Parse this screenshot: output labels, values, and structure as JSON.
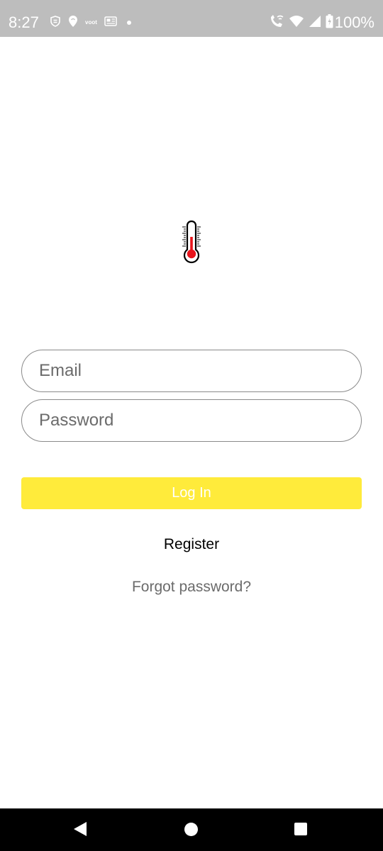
{
  "status_bar": {
    "time": "8:27",
    "left_icons": [
      "shield-s-icon",
      "location-pin-icon",
      "voot-icon",
      "news-icon",
      "dot-icon"
    ],
    "voot_label": "voot",
    "right_icons": [
      "wifi-call-icon",
      "wifi-icon",
      "signal-icon",
      "battery-icon"
    ],
    "battery_percent": "100%"
  },
  "logo": {
    "icon": "thermometer-icon",
    "accent_color": "#e8141c"
  },
  "form": {
    "email_placeholder": "Email",
    "password_placeholder": "Password",
    "login_label": "Log In",
    "login_color": "#ffeb3b",
    "register_label": "Register",
    "forgot_label": "Forgot password?"
  },
  "nav_bar": {
    "icons": [
      "back-icon",
      "home-icon",
      "recents-icon"
    ]
  }
}
